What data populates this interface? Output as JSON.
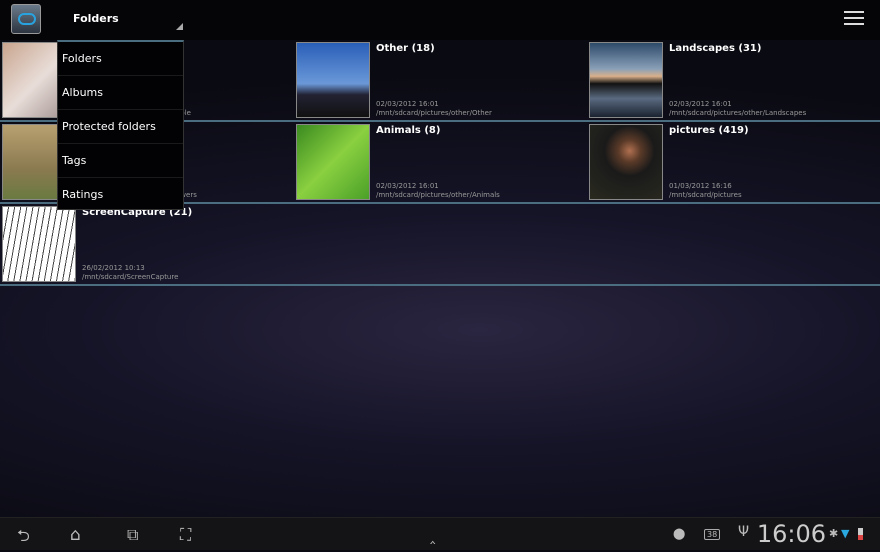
{
  "actionbar": {
    "spinner_value": "Folders"
  },
  "dropdown": {
    "items": [
      "Folders",
      "Albums",
      "Protected folders",
      "Tags",
      "Ratings"
    ]
  },
  "folders": [
    {
      "title": "",
      "date": "",
      "path": "ople"
    },
    {
      "title": "Other (18)",
      "date": "02/03/2012 16:01",
      "path": "/mnt/sdcard/pictures/other/Other"
    },
    {
      "title": "Landscapes (31)",
      "date": "02/03/2012 16:01",
      "path": "/mnt/sdcard/pictures/other/Landscapes"
    },
    {
      "title": "",
      "date": "",
      "path": "owers"
    },
    {
      "title": "Animals (8)",
      "date": "02/03/2012 16:01",
      "path": "/mnt/sdcard/pictures/other/Animals"
    },
    {
      "title": "pictures (419)",
      "date": "01/03/2012 16:16",
      "path": "/mnt/sdcard/pictures"
    },
    {
      "title": "ScreenCapture (21)",
      "date": "26/02/2012 10:13",
      "path": "/mnt/sdcard/ScreenCapture"
    }
  ],
  "status": {
    "time": "16:06",
    "notification_count": "38"
  }
}
